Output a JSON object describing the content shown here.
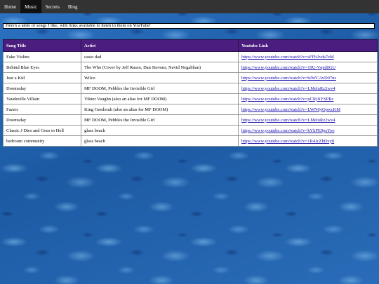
{
  "nav": {
    "items": [
      {
        "label": "Home"
      },
      {
        "label": "Music"
      },
      {
        "label": "Secrets"
      },
      {
        "label": "Blog"
      }
    ],
    "active": "Music"
  },
  "intro_text": "Here's a table of songs I like, with links available to listen to them on YouTube!",
  "table": {
    "headers": [
      "Song Title",
      "Artist",
      "Youtube Link"
    ],
    "rows": [
      {
        "title": "Fake Violins",
        "artist": "casio dad",
        "link": "https://www.youtube.com/watch?v=sFFh2vda7eM"
      },
      {
        "title": "Behind Blue Eyes",
        "artist": "The Who (Cover by Jeff Russo, Dan Stevens, Navid Negahban)",
        "link": "https://www.youtube.com/watch?v=19U-Vqed0GU"
      },
      {
        "title": "Just a Kid",
        "artist": "Wilco",
        "link": "https://www.youtube.com/watch?v=hJWCAvD07ns"
      },
      {
        "title": "Doomsday",
        "artist": "MF DOOM, Pebbles the Invisible Girl",
        "link": "https://www.youtube.com/watch?v=LMeluRz2wv4"
      },
      {
        "title": "Vaudeville Villain",
        "artist": "Viktor Vaughn (also an alias for MF DOOM)",
        "link": "https://www.youtube.com/watch?v=pCRjJiYSPRc"
      },
      {
        "title": "Fazers",
        "artist": "King Geedorah (also an alias for MF DOOM)",
        "link": "https://www.youtube.com/watch?v=LWN0yOpwcKM"
      },
      {
        "title": "Doomsday",
        "artist": "MF DOOM, Pebbles the Invisible Girl",
        "link": "https://www.youtube.com/watch?v=LMeluRz2wv4"
      },
      {
        "title": "Classic J Dies and Goes to Hell",
        "artist": "glass beach",
        "link": "https://www.youtube.com/watch?v=kYkPE9psYoo"
      },
      {
        "title": "bedroom community",
        "artist": "glass beach",
        "link": "https://www.youtube.com/watch?v=1R4JcZhDvy8"
      }
    ]
  },
  "colors": {
    "navbar": "#333333",
    "nav_active": "#111111",
    "table_header": "#4b1d7f",
    "background_water": "#1f5fa8"
  }
}
